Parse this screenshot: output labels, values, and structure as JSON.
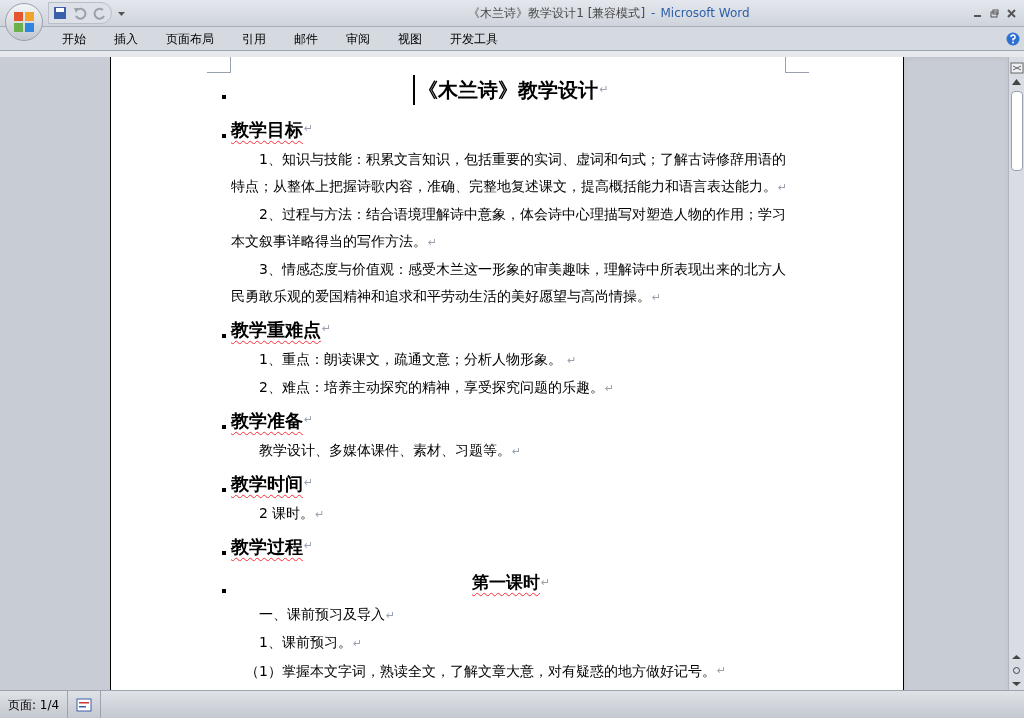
{
  "window": {
    "title": "《木兰诗》教学设计1 [兼容模式]",
    "separator": "-",
    "app_name": "Microsoft Word"
  },
  "ribbon_tabs": [
    {
      "label": "开始",
      "selected": false
    },
    {
      "label": "插入",
      "selected": false
    },
    {
      "label": "页面布局",
      "selected": false
    },
    {
      "label": "引用",
      "selected": false
    },
    {
      "label": "邮件",
      "selected": false
    },
    {
      "label": "审阅",
      "selected": false
    },
    {
      "label": "视图",
      "selected": false
    },
    {
      "label": "开发工具",
      "selected": false
    }
  ],
  "document": {
    "paragraphs": [
      {
        "kind": "title",
        "text": "《木兰诗》教学设计",
        "mark": "↵",
        "spelling_flag": false
      },
      {
        "kind": "heading",
        "text": "教学目标",
        "mark": "↵",
        "spelling_flag": true
      },
      {
        "kind": "body",
        "text": "1、知识与技能：积累文言知识，包括重要的实词、虚词和句式；了解古诗修辞用语的特点；从整体上把握诗歌内容，准确、完整地复述课文，提高概括能力和语言表达能力。",
        "mark": "↵"
      },
      {
        "kind": "body",
        "text": "2、过程与方法：结合语境理解诗中意象，体会诗中心理描写对塑造人物的作用；学习本文叙事详略得当的写作方法。",
        "mark": "↵"
      },
      {
        "kind": "body",
        "text": "3、情感态度与价值观：感受木兰这一形象的审美趣味，理解诗中所表现出来的北方人民勇敢乐观的爱国精神和追求和平劳动生活的美好愿望与高尚情操。",
        "mark": "↵"
      },
      {
        "kind": "heading",
        "text": "教学重难点",
        "mark": "↵",
        "spelling_flag": true
      },
      {
        "kind": "body",
        "text": "1、重点：朗读课文，疏通文意；分析人物形象。 ",
        "mark": "↵"
      },
      {
        "kind": "body",
        "text": "2、难点：培养主动探究的精神，享受探究问题的乐趣。",
        "mark": "↵"
      },
      {
        "kind": "heading",
        "text": "教学准备",
        "mark": "↵",
        "spelling_flag": true
      },
      {
        "kind": "body",
        "text": "教学设计、多媒体课件、素材、习题等。",
        "mark": "↵"
      },
      {
        "kind": "heading",
        "text": "教学时间",
        "mark": "↵",
        "spelling_flag": true
      },
      {
        "kind": "body",
        "text": "2 课时。",
        "mark": "↵"
      },
      {
        "kind": "heading",
        "text": "教学过程",
        "mark": "↵",
        "spelling_flag": true
      },
      {
        "kind": "subtitle",
        "text": "第一课时",
        "mark": "↵",
        "spelling_flag": true
      },
      {
        "kind": "body",
        "text": "一、课前预习及导入",
        "mark": "↵"
      },
      {
        "kind": "body",
        "text": "1、课前预习。",
        "mark": "↵"
      },
      {
        "kind": "body_hanging",
        "text": "（1）掌握本文字词，熟读全文，了解文章大意，对有疑惑的地方做好记号。",
        "mark": "↵"
      }
    ]
  },
  "status_bar": {
    "page": "页面: 1/4"
  }
}
